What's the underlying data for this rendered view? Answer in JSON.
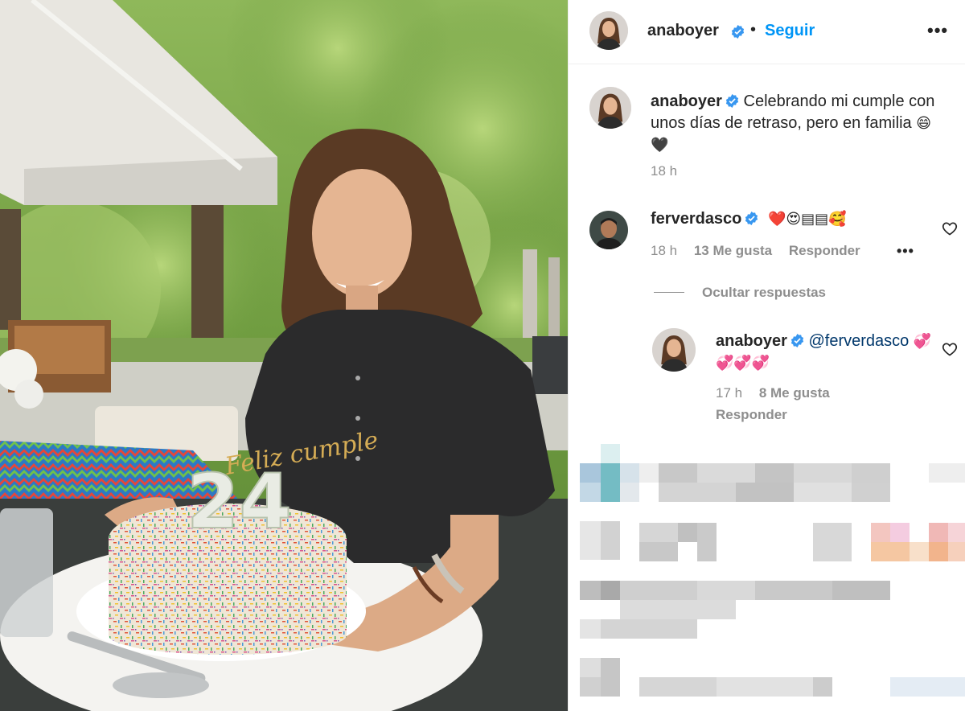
{
  "post_author": {
    "username": "anaboyer",
    "follow_label": "Seguir",
    "separator": "•",
    "more_label": "•••"
  },
  "caption": {
    "username": "anaboyer",
    "text": "Celebrando mi cumple con unos días de retraso, pero en familia",
    "emojis": "😄🖤",
    "time": "18 h"
  },
  "comments": [
    {
      "username": "ferverdasco",
      "text": "❤️😍▤▤🥰",
      "time": "18 h",
      "likes": "13 Me gusta",
      "reply_label": "Responder",
      "more_label": "•••"
    }
  ],
  "hide_replies_label": "Ocultar respuestas",
  "reply": {
    "username": "anaboyer",
    "mention": "@ferverdasco",
    "emojis": "💞💞💞💞",
    "time": "17 h",
    "likes": "8 Me gusta",
    "reply_label": "Responder"
  },
  "photo": {
    "cake_candle_text": "24",
    "topper_text": "Feliz cumple"
  },
  "colors": {
    "accent": "#0095f6",
    "verified": "#3897f0",
    "muted": "#8e8e8e",
    "mention": "#00376b"
  }
}
